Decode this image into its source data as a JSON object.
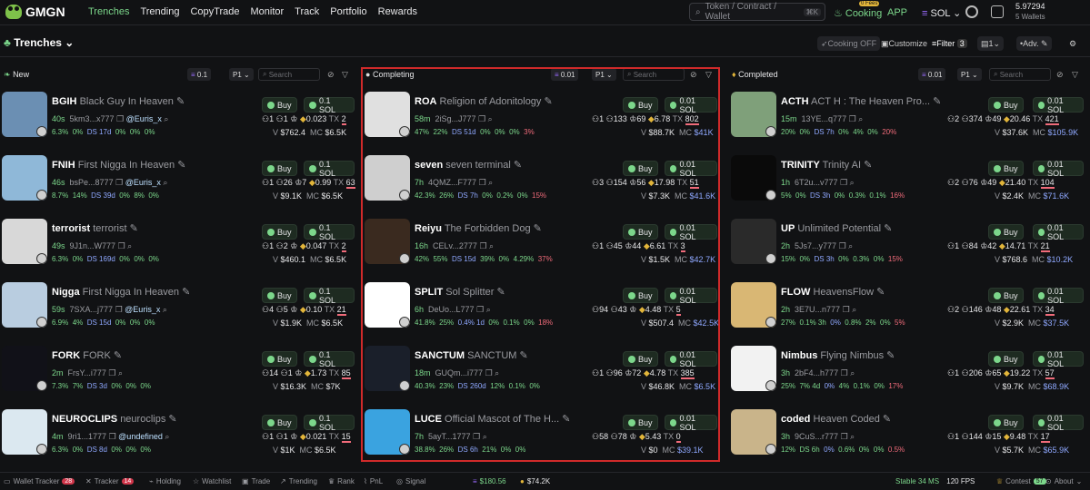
{
  "app": {
    "name": "GMGN"
  },
  "nav": [
    "Trenches",
    "Trending",
    "CopyTrade",
    "Monitor",
    "Track",
    "Portfolio",
    "Rewards"
  ],
  "search": {
    "placeholder": "Token / Contract / Wallet",
    "shortcut": "⌘K"
  },
  "header": {
    "cooking": "Cooking",
    "fees_badge": "0 Fees",
    "app": "APP",
    "chain": "SOL",
    "balance": "5.97294",
    "wallets": "5 Wallets"
  },
  "subbar": {
    "title": "Trenches",
    "cooking_off": "Cooking OFF",
    "customize": "Customize",
    "filter": "Filter",
    "filter_count": "3",
    "count": "1",
    "adv": "Adv."
  },
  "columns": {
    "new": {
      "title": "New",
      "amount": "0.1",
      "preset": "P1",
      "search": "Search"
    },
    "completing": {
      "title": "Completing",
      "amount": "0.01",
      "preset": "P1",
      "search": "Search"
    },
    "completed": {
      "title": "Completed",
      "amount": "0.01",
      "preset": "P1",
      "search": "Search"
    }
  },
  "new_tokens": [
    {
      "symbol": "BGIH",
      "name": "Black Guy In Heaven",
      "age": "40s",
      "addr": "5km3...x777",
      "twitter": "@Euris_x",
      "holders": "1",
      "h2": "1",
      "price": "0.023",
      "tx": "2",
      "p1": "6.3%",
      "p2": "0%",
      "p3": "DS 17d",
      "p4": "0%",
      "p5": "0%",
      "p6": "0%",
      "v": "$762.4",
      "mc": "$6.5K",
      "buy": "0.1 SOL",
      "bg": "#6b8fb3"
    },
    {
      "symbol": "FNIH",
      "name": "First Nigga In Heaven",
      "age": "46s",
      "addr": "bsPe...8777",
      "twitter": "@Euris_x",
      "holders": "1",
      "h2": "26",
      "h3": "7",
      "price": "0.99",
      "tx": "63",
      "p1": "8.7%",
      "p2": "14%",
      "p3": "DS 39d",
      "p4": "0%",
      "p5": "8%",
      "p6": "0%",
      "v": "$9.1K",
      "mc": "$6.5K",
      "buy": "0.1 SOL",
      "bg": "#8fb8d8"
    },
    {
      "symbol": "terrorist",
      "name": "terrorist",
      "age": "49s",
      "addr": "9J1n...W777",
      "twitter": "",
      "holders": "1",
      "h2": "2",
      "price": "0.047",
      "tx": "2",
      "p1": "6.3%",
      "p2": "0%",
      "p3": "DS 169d",
      "p4": "0%",
      "p5": "0%",
      "p6": "0%",
      "v": "$460.1",
      "mc": "$6.5K",
      "buy": "0.1 SOL",
      "bg": "#d8d8d8"
    },
    {
      "symbol": "Nigga",
      "name": "First Nigga In Heaven",
      "age": "59s",
      "addr": "7SXA...j777",
      "twitter": "@Euris_x",
      "holders": "4",
      "h2": "5",
      "price": "0.10",
      "tx": "21",
      "p1": "6.9%",
      "p2": "4%",
      "p3": "DS 15d",
      "p4": "0%",
      "p5": "0%",
      "p6": "0%",
      "v": "$1.9K",
      "mc": "$6.5K",
      "buy": "0.1 SOL",
      "bg": "#b9cde0"
    },
    {
      "symbol": "FORK",
      "name": "FORK",
      "age": "2m",
      "addr": "FrsY...i777",
      "twitter": "",
      "holders": "14",
      "h2": "1",
      "price": "1.73",
      "tx": "85",
      "p1": "7.3%",
      "p2": "7%",
      "p3": "DS 3d",
      "p4": "0%",
      "p5": "0%",
      "p6": "0%",
      "v": "$16.3K",
      "mc": "$7K",
      "buy": "0.1 SOL",
      "bg": "#111118"
    },
    {
      "symbol": "NEUROCLIPS",
      "name": "neuroclips",
      "age": "4m",
      "addr": "9ri1...1777",
      "twitter": "@undefined",
      "holders": "1",
      "h2": "1",
      "price": "0.021",
      "tx": "15",
      "p1": "6.3%",
      "p2": "0%",
      "p3": "DS 8d",
      "p4": "0%",
      "p5": "0%",
      "p6": "0%",
      "v": "$1K",
      "mc": "$6.5K",
      "buy": "0.1 SOL",
      "bg": "#dbe8f0"
    }
  ],
  "completing_tokens": [
    {
      "symbol": "ROA",
      "name": "Religion of Adonitology",
      "age": "58m",
      "addr": "2iSg...J777",
      "holders": "1",
      "h2": "133",
      "h3": "69",
      "price": "6.78",
      "tx": "802",
      "p1": "47%",
      "p2": "22%",
      "p3": "DS 51d",
      "p4": "0%",
      "p5": "0%",
      "p6": "0%",
      "p7": "3%",
      "v": "$88.7K",
      "mc": "$41K",
      "buy": "0.01 SOL",
      "bg": "#e0e0e0"
    },
    {
      "symbol": "seven",
      "name": "seven terminal",
      "age": "7h",
      "addr": "4QMZ...F777",
      "holders": "3",
      "h2": "154",
      "h3": "56",
      "price": "17.98",
      "tx": "51",
      "p1": "42.3%",
      "p2": "26%",
      "p3": "DS 7h",
      "p4": "0%",
      "p5": "0.2%",
      "p6": "0%",
      "p7": "15%",
      "v": "$7.3K",
      "mc": "$41.6K",
      "buy": "0.01 SOL",
      "bg": "#cfcfcf"
    },
    {
      "symbol": "Reiyu",
      "name": "The Forbidden Dog",
      "age": "16h",
      "addr": "CELv...2777",
      "holders": "1",
      "h2": "45",
      "h3": "44",
      "price": "6.61",
      "tx": "3",
      "p1": "42%",
      "p2": "55%",
      "p3": "DS 15d",
      "p4": "39%",
      "p5": "0%",
      "p6": "4.29%",
      "p7": "37%",
      "v": "$1.5K",
      "mc": "$42.7K",
      "buy": "0.01 SOL",
      "bg": "#3a2a1f"
    },
    {
      "symbol": "SPLIT",
      "name": "Sol Splitter",
      "age": "6h",
      "addr": "DeUo...L777",
      "holders": "94",
      "h2": "43",
      "h3": "",
      "price": "4.48",
      "tx": "5",
      "p1": "41.8%",
      "p2": "25%",
      "p3": "0.4% 1d",
      "p4": "0%",
      "p5": "0.1%",
      "p6": "0%",
      "p7": "18%",
      "v": "$507.4",
      "mc": "$42.5K",
      "buy": "0.01 SOL",
      "bg": "#ffffff"
    },
    {
      "symbol": "SANCTUM",
      "name": "SANCTUM",
      "age": "18m",
      "addr": "GUQm...i777",
      "holders": "1",
      "h2": "96",
      "h3": "72",
      "price": "4.78",
      "tx": "385",
      "p1": "40.3%",
      "p2": "23%",
      "p3": "DS 260d",
      "p4": "12%",
      "p5": "0.1%",
      "p6": "0%",
      "p7": "",
      "v": "$46.8K",
      "mc": "$6.5K",
      "buy": "0.01 SOL",
      "bg": "#1a1f2a"
    },
    {
      "symbol": "LUCE",
      "name": "Official Mascot of The H...",
      "age": "7h",
      "addr": "5ayT...1777",
      "holders": "58",
      "h2": "78",
      "h3": "",
      "price": "5.43",
      "tx": "0",
      "p1": "38.8%",
      "p2": "26%",
      "p3": "DS 6h",
      "p4": "21%",
      "p5": "0%",
      "p6": "0%",
      "p7": "",
      "v": "$0",
      "mc": "$39.1K",
      "buy": "0.01 SOL",
      "bg": "#3aa3e0"
    }
  ],
  "completed_tokens": [
    {
      "symbol": "ACTH",
      "name": "ACT H : The Heaven Pro...",
      "age": "15m",
      "addr": "13YE...q777",
      "holders": "2",
      "h2": "374",
      "h3": "49",
      "price": "20.46",
      "tx": "421",
      "p1": "20%",
      "p2": "0%",
      "p3": "DS 7h",
      "p4": "0%",
      "p5": "4%",
      "p6": "0%",
      "p7": "20%",
      "v": "$37.6K",
      "mc": "$105.9K",
      "buy": "0.01 SOL",
      "bg": "#7fa07a"
    },
    {
      "symbol": "TRINITY",
      "name": "Trinity AI",
      "age": "1h",
      "addr": "6T2u...v777",
      "holders": "2",
      "h2": "76",
      "h3": "49",
      "price": "21.40",
      "tx": "104",
      "p1": "5%",
      "p2": "0%",
      "p3": "DS 3h",
      "p4": "0%",
      "p5": "0.3%",
      "p6": "0.1%",
      "p7": "16%",
      "v": "$2.4K",
      "mc": "$71.6K",
      "buy": "0.01 SOL",
      "bg": "#0a0a0a"
    },
    {
      "symbol": "UP",
      "name": "Unlimited Potential",
      "age": "2h",
      "addr": "5Js7...y777",
      "holders": "1",
      "h2": "84",
      "h3": "42",
      "price": "14.71",
      "tx": "21",
      "p1": "15%",
      "p2": "0%",
      "p3": "DS 3h",
      "p4": "0%",
      "p5": "0.3%",
      "p6": "0%",
      "p7": "15%",
      "v": "$768.6",
      "mc": "$10.2K",
      "buy": "0.01 SOL",
      "bg": "#2a2a2a"
    },
    {
      "symbol": "FLOW",
      "name": "HeavensFlow",
      "age": "2h",
      "addr": "3E7U...n777",
      "holders": "2",
      "h2": "146",
      "h3": "48",
      "price": "22.61",
      "tx": "34",
      "p1": "27%",
      "p2": "0.1% 3h",
      "p3": "0%",
      "p4": "0.8%",
      "p5": "2%",
      "p6": "0%",
      "p7": "5%",
      "v": "$2.9K",
      "mc": "$37.5K",
      "buy": "0.01 SOL",
      "bg": "#d9b774"
    },
    {
      "symbol": "Nimbus",
      "name": "Flying Nimbus",
      "age": "3h",
      "addr": "2bF4...h777",
      "holders": "1",
      "h2": "206",
      "h3": "65",
      "price": "19.22",
      "tx": "57",
      "p1": "25%",
      "p2": "7% 4d",
      "p3": "0%",
      "p4": "4%",
      "p5": "0.1%",
      "p6": "0%",
      "p7": "17%",
      "v": "$9.7K",
      "mc": "$68.9K",
      "buy": "0.01 SOL",
      "bg": "#f2f2f2"
    },
    {
      "symbol": "coded",
      "name": "Heaven Coded",
      "age": "3h",
      "addr": "9CuS...r777",
      "holders": "1",
      "h2": "144",
      "h3": "15",
      "price": "9.48",
      "tx": "17",
      "p1": "12%",
      "p2": "DS 6h",
      "p3": "0%",
      "p4": "0.6%",
      "p5": "0%",
      "p6": "0%",
      "p7": "0.5%",
      "v": "$5.7K",
      "mc": "$65.9K",
      "buy": "0.01 SOL",
      "bg": "#c9b48a"
    }
  ],
  "footer": {
    "wallet_tracker": "Wallet Tracker",
    "wallet_tracker_count": "28",
    "tracker": "Tracker",
    "tracker_count": "14",
    "holding": "Holding",
    "watchlist": "Watchlist",
    "trade": "Trade",
    "trending": "Trending",
    "rank": "Rank",
    "pnl": "PnL",
    "signal": "Signal",
    "sol_price": "$180.56",
    "other_price": "$74.2K",
    "stable": "Stable 34 MS",
    "fps": "120 FPS",
    "contest": "Contest",
    "contest_count": "57",
    "about": "About"
  },
  "colors": {
    "accent": "#7cd78b",
    "danger": "#f06b7a",
    "frame": "#d02a2a"
  }
}
